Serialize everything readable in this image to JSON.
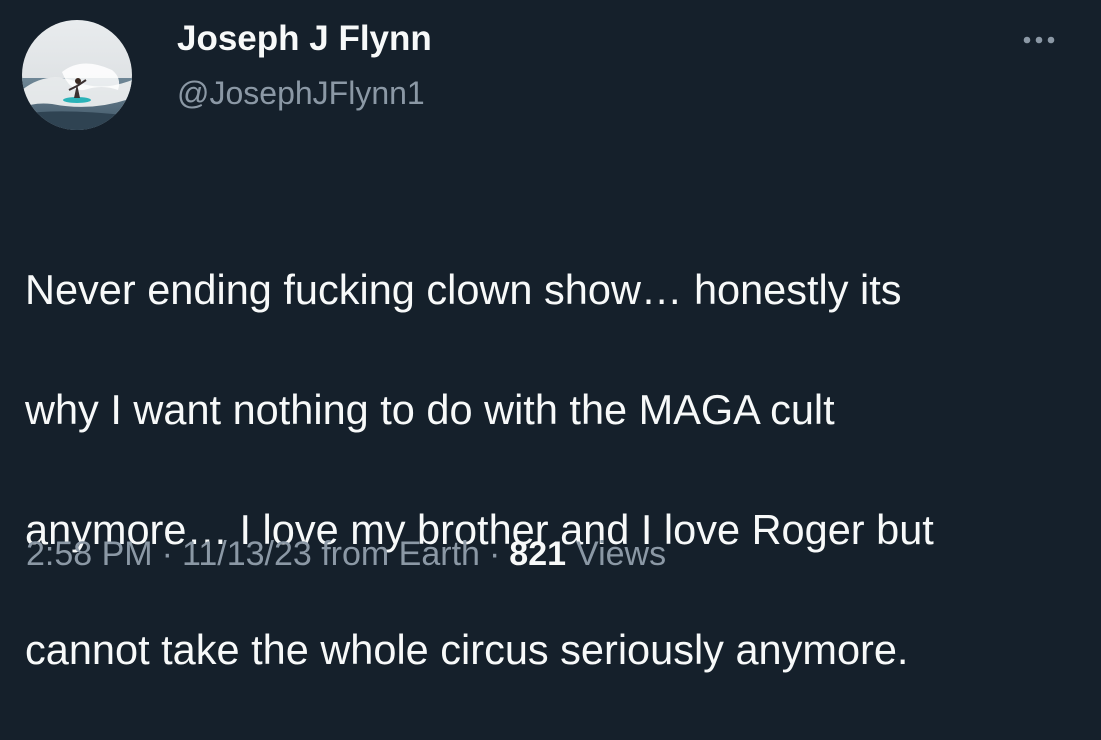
{
  "author": {
    "display_name": "Joseph J Flynn",
    "handle": "@JosephJFlynn1",
    "avatar_icon": "surfer-photo-avatar"
  },
  "more_icon": "more-options-icon",
  "tweet": {
    "text_lines": [
      "Never ending fucking clown show… honestly its",
      "why I want nothing to do with the MAGA cult",
      "anymore… I love my brother and I love Roger but",
      "cannot take the whole circus seriously anymore."
    ]
  },
  "meta": {
    "time": "2:58 PM",
    "separator": "·",
    "date": "11/13/23",
    "source": "from Earth",
    "views_count": "821",
    "views_label": "Views"
  },
  "colors": {
    "background": "#15202b",
    "primary_text": "#f7f9f9",
    "secondary_text": "#8b98a5"
  }
}
